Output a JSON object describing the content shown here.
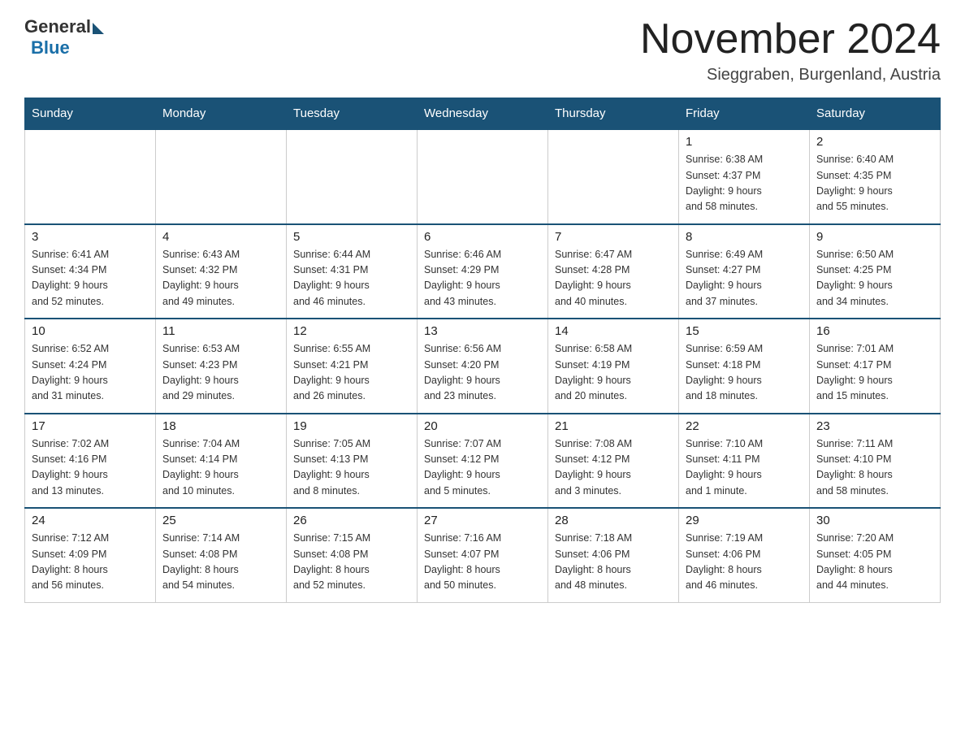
{
  "logo": {
    "general": "General",
    "blue": "Blue"
  },
  "header": {
    "month_year": "November 2024",
    "location": "Sieggraben, Burgenland, Austria"
  },
  "weekdays": [
    "Sunday",
    "Monday",
    "Tuesday",
    "Wednesday",
    "Thursday",
    "Friday",
    "Saturday"
  ],
  "weeks": [
    [
      {
        "day": "",
        "info": ""
      },
      {
        "day": "",
        "info": ""
      },
      {
        "day": "",
        "info": ""
      },
      {
        "day": "",
        "info": ""
      },
      {
        "day": "",
        "info": ""
      },
      {
        "day": "1",
        "info": "Sunrise: 6:38 AM\nSunset: 4:37 PM\nDaylight: 9 hours\nand 58 minutes."
      },
      {
        "day": "2",
        "info": "Sunrise: 6:40 AM\nSunset: 4:35 PM\nDaylight: 9 hours\nand 55 minutes."
      }
    ],
    [
      {
        "day": "3",
        "info": "Sunrise: 6:41 AM\nSunset: 4:34 PM\nDaylight: 9 hours\nand 52 minutes."
      },
      {
        "day": "4",
        "info": "Sunrise: 6:43 AM\nSunset: 4:32 PM\nDaylight: 9 hours\nand 49 minutes."
      },
      {
        "day": "5",
        "info": "Sunrise: 6:44 AM\nSunset: 4:31 PM\nDaylight: 9 hours\nand 46 minutes."
      },
      {
        "day": "6",
        "info": "Sunrise: 6:46 AM\nSunset: 4:29 PM\nDaylight: 9 hours\nand 43 minutes."
      },
      {
        "day": "7",
        "info": "Sunrise: 6:47 AM\nSunset: 4:28 PM\nDaylight: 9 hours\nand 40 minutes."
      },
      {
        "day": "8",
        "info": "Sunrise: 6:49 AM\nSunset: 4:27 PM\nDaylight: 9 hours\nand 37 minutes."
      },
      {
        "day": "9",
        "info": "Sunrise: 6:50 AM\nSunset: 4:25 PM\nDaylight: 9 hours\nand 34 minutes."
      }
    ],
    [
      {
        "day": "10",
        "info": "Sunrise: 6:52 AM\nSunset: 4:24 PM\nDaylight: 9 hours\nand 31 minutes."
      },
      {
        "day": "11",
        "info": "Sunrise: 6:53 AM\nSunset: 4:23 PM\nDaylight: 9 hours\nand 29 minutes."
      },
      {
        "day": "12",
        "info": "Sunrise: 6:55 AM\nSunset: 4:21 PM\nDaylight: 9 hours\nand 26 minutes."
      },
      {
        "day": "13",
        "info": "Sunrise: 6:56 AM\nSunset: 4:20 PM\nDaylight: 9 hours\nand 23 minutes."
      },
      {
        "day": "14",
        "info": "Sunrise: 6:58 AM\nSunset: 4:19 PM\nDaylight: 9 hours\nand 20 minutes."
      },
      {
        "day": "15",
        "info": "Sunrise: 6:59 AM\nSunset: 4:18 PM\nDaylight: 9 hours\nand 18 minutes."
      },
      {
        "day": "16",
        "info": "Sunrise: 7:01 AM\nSunset: 4:17 PM\nDaylight: 9 hours\nand 15 minutes."
      }
    ],
    [
      {
        "day": "17",
        "info": "Sunrise: 7:02 AM\nSunset: 4:16 PM\nDaylight: 9 hours\nand 13 minutes."
      },
      {
        "day": "18",
        "info": "Sunrise: 7:04 AM\nSunset: 4:14 PM\nDaylight: 9 hours\nand 10 minutes."
      },
      {
        "day": "19",
        "info": "Sunrise: 7:05 AM\nSunset: 4:13 PM\nDaylight: 9 hours\nand 8 minutes."
      },
      {
        "day": "20",
        "info": "Sunrise: 7:07 AM\nSunset: 4:12 PM\nDaylight: 9 hours\nand 5 minutes."
      },
      {
        "day": "21",
        "info": "Sunrise: 7:08 AM\nSunset: 4:12 PM\nDaylight: 9 hours\nand 3 minutes."
      },
      {
        "day": "22",
        "info": "Sunrise: 7:10 AM\nSunset: 4:11 PM\nDaylight: 9 hours\nand 1 minute."
      },
      {
        "day": "23",
        "info": "Sunrise: 7:11 AM\nSunset: 4:10 PM\nDaylight: 8 hours\nand 58 minutes."
      }
    ],
    [
      {
        "day": "24",
        "info": "Sunrise: 7:12 AM\nSunset: 4:09 PM\nDaylight: 8 hours\nand 56 minutes."
      },
      {
        "day": "25",
        "info": "Sunrise: 7:14 AM\nSunset: 4:08 PM\nDaylight: 8 hours\nand 54 minutes."
      },
      {
        "day": "26",
        "info": "Sunrise: 7:15 AM\nSunset: 4:08 PM\nDaylight: 8 hours\nand 52 minutes."
      },
      {
        "day": "27",
        "info": "Sunrise: 7:16 AM\nSunset: 4:07 PM\nDaylight: 8 hours\nand 50 minutes."
      },
      {
        "day": "28",
        "info": "Sunrise: 7:18 AM\nSunset: 4:06 PM\nDaylight: 8 hours\nand 48 minutes."
      },
      {
        "day": "29",
        "info": "Sunrise: 7:19 AM\nSunset: 4:06 PM\nDaylight: 8 hours\nand 46 minutes."
      },
      {
        "day": "30",
        "info": "Sunrise: 7:20 AM\nSunset: 4:05 PM\nDaylight: 8 hours\nand 44 minutes."
      }
    ]
  ]
}
